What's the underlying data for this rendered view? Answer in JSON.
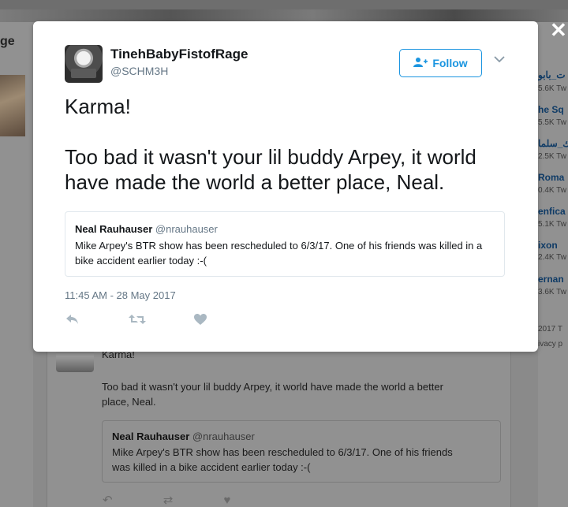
{
  "background": {
    "left_label": "ge",
    "feed_text_line1": "Karma!",
    "feed_text_line2": "Too bad it wasn't your lil buddy Arpey, it world have made the world a better",
    "feed_text_line3": "place, Neal.",
    "feed_quote_name": "Neal Rauhauser",
    "feed_quote_handle": "@nrauhauser",
    "feed_quote_line1": "Mike Arpey's BTR show has been rescheduled to 6/3/17. One of his friends",
    "feed_quote_line2": "was killed in a bike accident earlier today :-(",
    "trends": [
      {
        "name": "ت_بابو",
        "count": "5.6K Tw"
      },
      {
        "name": "he Sq",
        "count": "5.5K Tw"
      },
      {
        "name": "ك_سلما",
        "count": "2.5K Tw"
      },
      {
        "name": "Roma",
        "count": "0.4K Tw"
      },
      {
        "name": "enfica",
        "count": "5.1K Tw"
      },
      {
        "name": "ixon",
        "count": "2.4K Tw"
      },
      {
        "name": "ernan",
        "count": "3.6K Tw"
      }
    ],
    "footer_line1": "2017 T",
    "footer_line2": "ivacy p"
  },
  "close_label": "✕",
  "tweet": {
    "user_name": "TinehBabyFistofRage",
    "user_handle": "@SCHM3H",
    "follow_label": "Follow",
    "text": "Karma!\n\nToo bad it wasn't your lil buddy Arpey, it world have made the world a better place, Neal.",
    "quoted": {
      "name": "Neal Rauhauser",
      "handle": "@nrauhauser",
      "text": "Mike Arpey's BTR show has been rescheduled to 6/3/17. One of his friends was killed in a bike accident earlier today :-("
    },
    "timestamp": "11:45 AM - 28 May 2017"
  },
  "colors": {
    "accent": "#1b95e0",
    "secondary_text": "#657786",
    "action_icon": "#aab8c2"
  },
  "icons": [
    "reply-icon",
    "retweet-icon",
    "like-icon",
    "add-user-icon",
    "chevron-down-icon",
    "close-icon"
  ]
}
